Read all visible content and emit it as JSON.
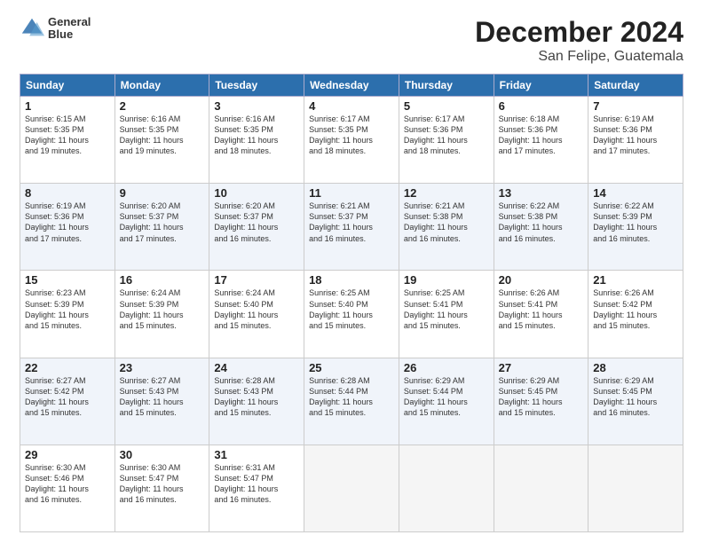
{
  "logo": {
    "line1": "General",
    "line2": "Blue"
  },
  "title": "December 2024",
  "subtitle": "San Felipe, Guatemala",
  "days_of_week": [
    "Sunday",
    "Monday",
    "Tuesday",
    "Wednesday",
    "Thursday",
    "Friday",
    "Saturday"
  ],
  "weeks": [
    [
      {
        "day": "1",
        "info": "Sunrise: 6:15 AM\nSunset: 5:35 PM\nDaylight: 11 hours\nand 19 minutes."
      },
      {
        "day": "2",
        "info": "Sunrise: 6:16 AM\nSunset: 5:35 PM\nDaylight: 11 hours\nand 19 minutes."
      },
      {
        "day": "3",
        "info": "Sunrise: 6:16 AM\nSunset: 5:35 PM\nDaylight: 11 hours\nand 18 minutes."
      },
      {
        "day": "4",
        "info": "Sunrise: 6:17 AM\nSunset: 5:35 PM\nDaylight: 11 hours\nand 18 minutes."
      },
      {
        "day": "5",
        "info": "Sunrise: 6:17 AM\nSunset: 5:36 PM\nDaylight: 11 hours\nand 18 minutes."
      },
      {
        "day": "6",
        "info": "Sunrise: 6:18 AM\nSunset: 5:36 PM\nDaylight: 11 hours\nand 17 minutes."
      },
      {
        "day": "7",
        "info": "Sunrise: 6:19 AM\nSunset: 5:36 PM\nDaylight: 11 hours\nand 17 minutes."
      }
    ],
    [
      {
        "day": "8",
        "info": "Sunrise: 6:19 AM\nSunset: 5:36 PM\nDaylight: 11 hours\nand 17 minutes."
      },
      {
        "day": "9",
        "info": "Sunrise: 6:20 AM\nSunset: 5:37 PM\nDaylight: 11 hours\nand 17 minutes."
      },
      {
        "day": "10",
        "info": "Sunrise: 6:20 AM\nSunset: 5:37 PM\nDaylight: 11 hours\nand 16 minutes."
      },
      {
        "day": "11",
        "info": "Sunrise: 6:21 AM\nSunset: 5:37 PM\nDaylight: 11 hours\nand 16 minutes."
      },
      {
        "day": "12",
        "info": "Sunrise: 6:21 AM\nSunset: 5:38 PM\nDaylight: 11 hours\nand 16 minutes."
      },
      {
        "day": "13",
        "info": "Sunrise: 6:22 AM\nSunset: 5:38 PM\nDaylight: 11 hours\nand 16 minutes."
      },
      {
        "day": "14",
        "info": "Sunrise: 6:22 AM\nSunset: 5:39 PM\nDaylight: 11 hours\nand 16 minutes."
      }
    ],
    [
      {
        "day": "15",
        "info": "Sunrise: 6:23 AM\nSunset: 5:39 PM\nDaylight: 11 hours\nand 15 minutes."
      },
      {
        "day": "16",
        "info": "Sunrise: 6:24 AM\nSunset: 5:39 PM\nDaylight: 11 hours\nand 15 minutes."
      },
      {
        "day": "17",
        "info": "Sunrise: 6:24 AM\nSunset: 5:40 PM\nDaylight: 11 hours\nand 15 minutes."
      },
      {
        "day": "18",
        "info": "Sunrise: 6:25 AM\nSunset: 5:40 PM\nDaylight: 11 hours\nand 15 minutes."
      },
      {
        "day": "19",
        "info": "Sunrise: 6:25 AM\nSunset: 5:41 PM\nDaylight: 11 hours\nand 15 minutes."
      },
      {
        "day": "20",
        "info": "Sunrise: 6:26 AM\nSunset: 5:41 PM\nDaylight: 11 hours\nand 15 minutes."
      },
      {
        "day": "21",
        "info": "Sunrise: 6:26 AM\nSunset: 5:42 PM\nDaylight: 11 hours\nand 15 minutes."
      }
    ],
    [
      {
        "day": "22",
        "info": "Sunrise: 6:27 AM\nSunset: 5:42 PM\nDaylight: 11 hours\nand 15 minutes."
      },
      {
        "day": "23",
        "info": "Sunrise: 6:27 AM\nSunset: 5:43 PM\nDaylight: 11 hours\nand 15 minutes."
      },
      {
        "day": "24",
        "info": "Sunrise: 6:28 AM\nSunset: 5:43 PM\nDaylight: 11 hours\nand 15 minutes."
      },
      {
        "day": "25",
        "info": "Sunrise: 6:28 AM\nSunset: 5:44 PM\nDaylight: 11 hours\nand 15 minutes."
      },
      {
        "day": "26",
        "info": "Sunrise: 6:29 AM\nSunset: 5:44 PM\nDaylight: 11 hours\nand 15 minutes."
      },
      {
        "day": "27",
        "info": "Sunrise: 6:29 AM\nSunset: 5:45 PM\nDaylight: 11 hours\nand 15 minutes."
      },
      {
        "day": "28",
        "info": "Sunrise: 6:29 AM\nSunset: 5:45 PM\nDaylight: 11 hours\nand 16 minutes."
      }
    ],
    [
      {
        "day": "29",
        "info": "Sunrise: 6:30 AM\nSunset: 5:46 PM\nDaylight: 11 hours\nand 16 minutes."
      },
      {
        "day": "30",
        "info": "Sunrise: 6:30 AM\nSunset: 5:47 PM\nDaylight: 11 hours\nand 16 minutes."
      },
      {
        "day": "31",
        "info": "Sunrise: 6:31 AM\nSunset: 5:47 PM\nDaylight: 11 hours\nand 16 minutes."
      },
      {
        "day": "",
        "info": ""
      },
      {
        "day": "",
        "info": ""
      },
      {
        "day": "",
        "info": ""
      },
      {
        "day": "",
        "info": ""
      }
    ]
  ]
}
